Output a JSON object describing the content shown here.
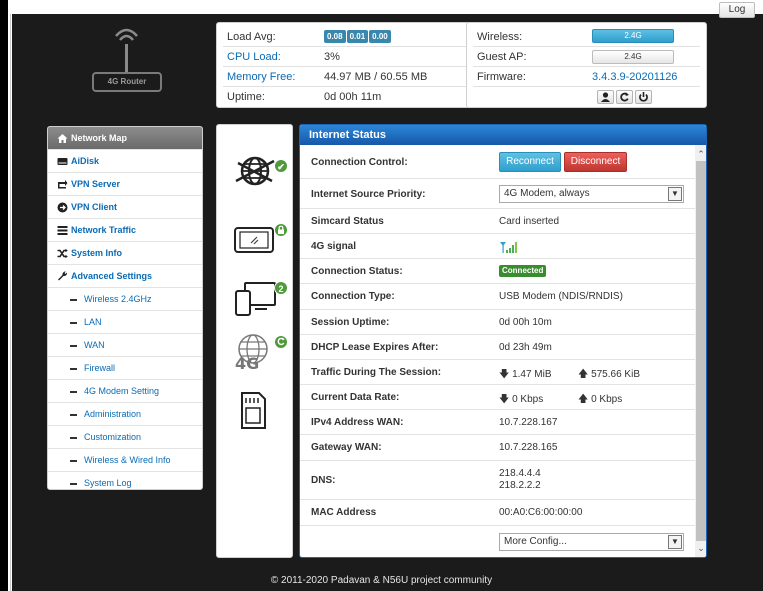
{
  "top": {
    "log_button": "Log"
  },
  "logo": {
    "label": "4G Router",
    "icon": "router-icon"
  },
  "system_info": {
    "rows": [
      {
        "key": "Load Avg:",
        "badges": [
          "0.08",
          "0.01",
          "0.00"
        ]
      },
      {
        "key": "CPU Load:",
        "value": "3%"
      },
      {
        "key": "Memory Free:",
        "value": "44.97 MB / 60.55 MB"
      },
      {
        "key": "Uptime:",
        "value": "0d 00h 11m"
      }
    ]
  },
  "wireless_info": {
    "wireless_label": "Wireless:",
    "wireless_value": "2.4G",
    "guest_label": "Guest AP:",
    "guest_value": "2.4G",
    "firmware_label": "Firmware:",
    "firmware_value": "3.4.3.9-20201126",
    "buttons": [
      "user-icon",
      "refresh-icon",
      "power-icon"
    ]
  },
  "sidebar": {
    "items": [
      {
        "label": "Network Map",
        "icon": "home-icon",
        "active": true
      },
      {
        "label": "AiDisk",
        "icon": "disk-icon"
      },
      {
        "label": "VPN Server",
        "icon": "vpn-server-icon"
      },
      {
        "label": "VPN Client",
        "icon": "vpn-client-icon"
      },
      {
        "label": "Network Traffic",
        "icon": "traffic-icon"
      },
      {
        "label": "System Info",
        "icon": "shuffle-icon"
      },
      {
        "label": "Advanced Settings",
        "icon": "wrench-icon"
      }
    ],
    "sub_items": [
      "Wireless 2.4GHz",
      "LAN",
      "WAN",
      "Firewall",
      "4G Modem Setting",
      "Administration",
      "Customization",
      "Wireless & Wired Info",
      "System Log"
    ]
  },
  "status_icons": [
    {
      "name": "internet-globe-icon",
      "badge": "✔"
    },
    {
      "name": "tablet-icon",
      "badge": "lock-icon"
    },
    {
      "name": "clients-monitor-icon",
      "badge": "2"
    },
    {
      "name": "4g-globe-icon",
      "badge": "refresh-icon"
    },
    {
      "name": "sd-card-icon",
      "badge": ""
    }
  ],
  "internet_status": {
    "title": "Internet Status",
    "rows": [
      {
        "key": "Connection Control:",
        "reconnect": "Reconnect",
        "disconnect": "Disconnect"
      },
      {
        "key": "Internet Source Priority:",
        "select": "4G Modem, always"
      },
      {
        "key": "Simcard Status",
        "value": "Card inserted"
      },
      {
        "key": "4G signal",
        "signal_icon": "signal-bars-icon"
      },
      {
        "key": "Connection Status:",
        "badge": "Connected"
      },
      {
        "key": "Connection Type:",
        "value": "USB Modem (NDIS/RNDIS)"
      },
      {
        "key": "Session Uptime:",
        "value": "0d 00h 10m"
      },
      {
        "key": "DHCP Lease Expires After:",
        "value": "0d 23h 49m"
      },
      {
        "key": "Traffic During The Session:",
        "down": "1.47 MiB",
        "up": "575.66 KiB"
      },
      {
        "key": "Current Data Rate:",
        "down": "0 Kbps",
        "up": "0 Kbps"
      },
      {
        "key": "IPv4 Address WAN:",
        "value": "10.7.228.167"
      },
      {
        "key": "Gateway WAN:",
        "value": "10.7.228.165"
      },
      {
        "key": "DNS:",
        "value_line1": "218.4.4.4",
        "value_line2": "218.2.2.2"
      },
      {
        "key": "MAC Address",
        "value": "00:A0:C6:00:00:00"
      }
    ],
    "more_config": "More Config..."
  },
  "footer": "© 2011-2020 Padavan & N56U project community",
  "colors": {
    "accent_blue": "#1d63b7",
    "link": "#0a6bb5",
    "danger": "#bd362f",
    "success": "#3a8d2f"
  }
}
